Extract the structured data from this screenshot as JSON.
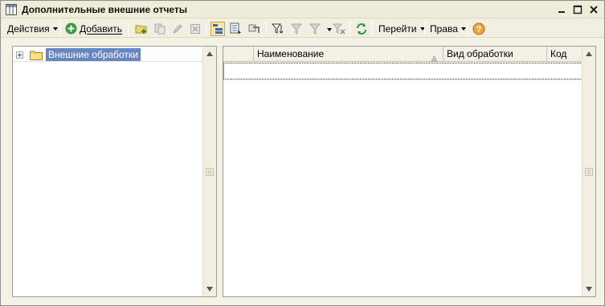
{
  "window": {
    "title": "Дополнительные внешние отчеты"
  },
  "toolbar": {
    "actions_label": "Действия",
    "add_label": "Добавить",
    "goto_label": "Перейти",
    "rights_label": "Права"
  },
  "tree": {
    "root_label": "Внешние обработки"
  },
  "grid": {
    "columns": [
      "Наименование",
      "Вид обработки",
      "Код"
    ],
    "rows": []
  },
  "colors": {
    "selection": "#6787c4",
    "window_bg": "#f4f1e5",
    "active_tool": "#f7e6a5"
  }
}
